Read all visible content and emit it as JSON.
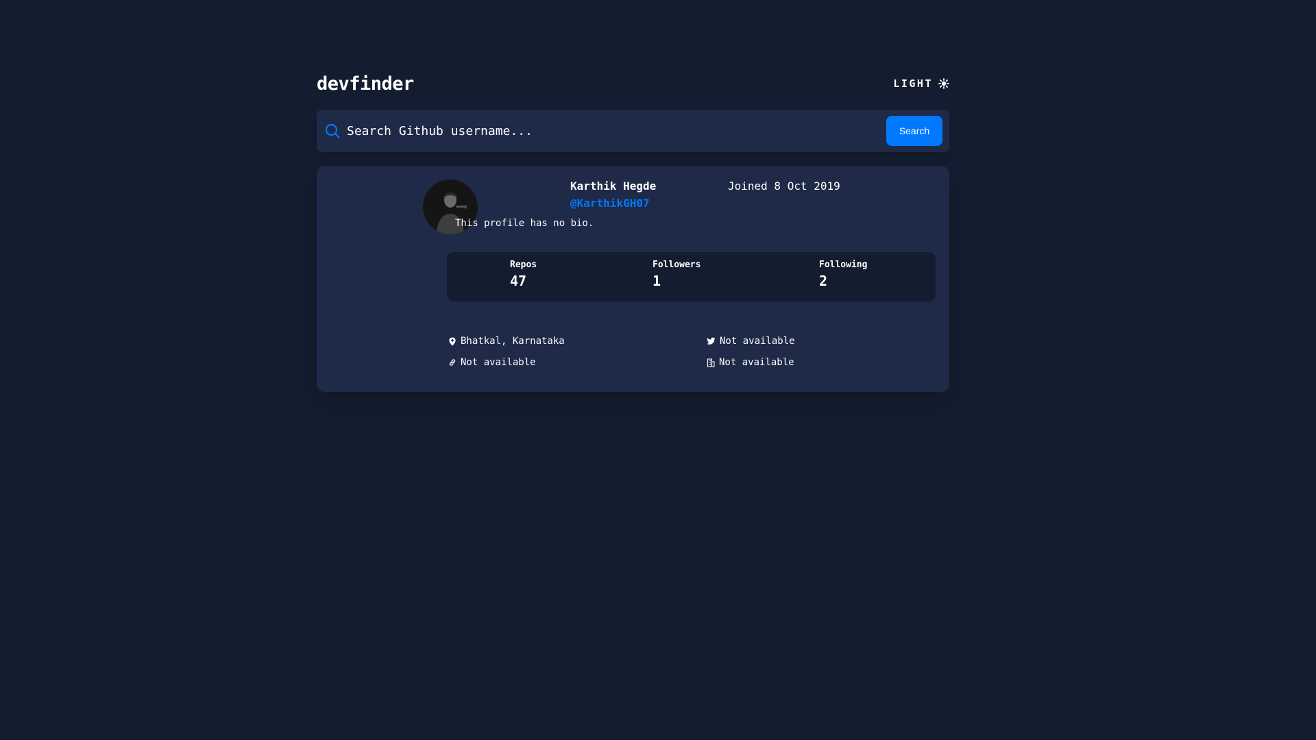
{
  "header": {
    "logo": "devfinder",
    "theme_toggle_label": "LIGHT"
  },
  "search": {
    "placeholder": "Search Github username...",
    "button_label": "Search"
  },
  "profile": {
    "name": "Karthik Hegde",
    "login": "@KarthikGH07",
    "joined": "Joined 8 Oct 2019",
    "bio": "This profile has no bio.",
    "stats": {
      "repos_label": "Repos",
      "repos_value": "47",
      "followers_label": "Followers",
      "followers_value": "1",
      "following_label": "Following",
      "following_value": "2"
    },
    "links": {
      "location": "Bhatkal, Karnataka",
      "twitter": "Not available",
      "blog": "Not available",
      "company": "Not available"
    }
  },
  "icons": {
    "theme": "sun-icon",
    "search": "search-icon",
    "location": "location-pin-icon",
    "twitter": "twitter-icon",
    "blog": "link-icon",
    "company": "building-icon"
  },
  "colors": {
    "background": "#141d2f",
    "card": "#1e2a47",
    "accent": "#0079ff",
    "text": "#ffffff"
  }
}
